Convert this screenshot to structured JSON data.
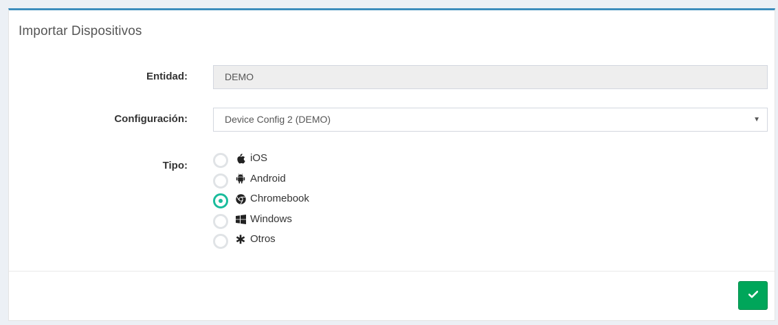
{
  "panel": {
    "title": "Importar Dispositivos"
  },
  "form": {
    "entidad": {
      "label": "Entidad:",
      "value": "DEMO"
    },
    "configuracion": {
      "label": "Configuración:",
      "selected": "Device Config 2 (DEMO)",
      "caret": "▼"
    },
    "tipo": {
      "label": "Tipo:",
      "options": [
        {
          "label": "iOS",
          "icon": "apple-icon",
          "checked": false
        },
        {
          "label": "Android",
          "icon": "android-icon",
          "checked": false
        },
        {
          "label": "Chromebook",
          "icon": "chrome-icon",
          "checked": true
        },
        {
          "label": "Windows",
          "icon": "windows-icon",
          "checked": false
        },
        {
          "label": "Otros",
          "icon": "asterisk-icon",
          "checked": false
        }
      ]
    }
  },
  "footer": {
    "submit_icon": "check-icon"
  },
  "colors": {
    "accent_top_border": "#3c8dbc",
    "radio_checked": "#1abc9c",
    "submit_button": "#00a65a"
  }
}
